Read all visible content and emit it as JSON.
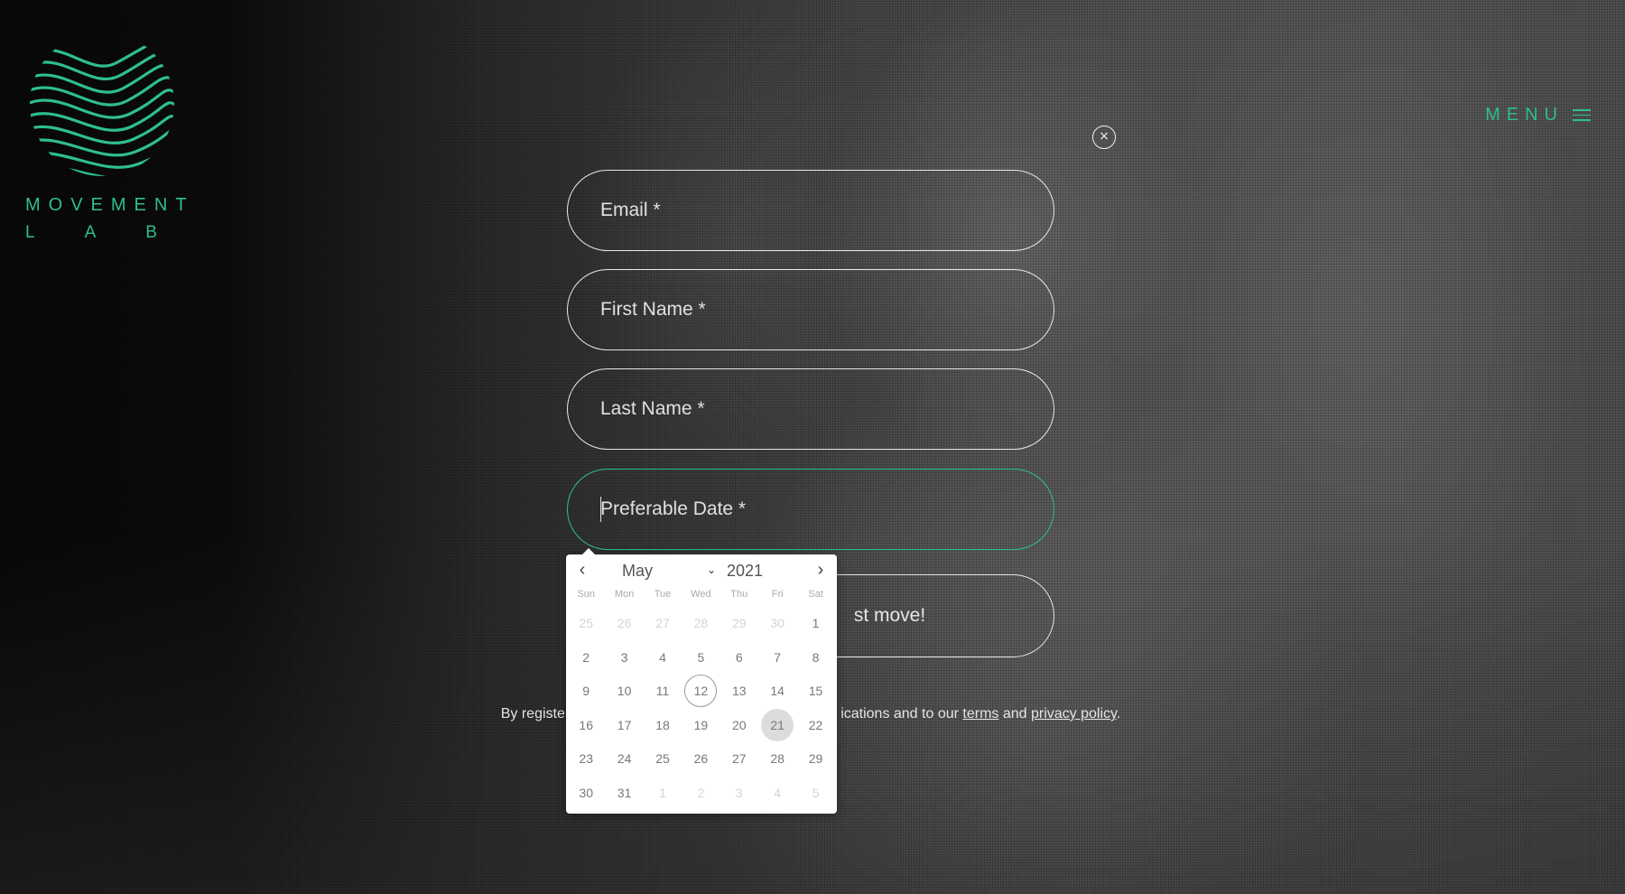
{
  "brand": {
    "line1": "MOVEMENT",
    "line2": "LAB",
    "accent_color": "#2fbf8a",
    "logo_icon": "wave-globe-icon"
  },
  "nav": {
    "menu_label": "MENU",
    "menu_icon": "hamburger-icon"
  },
  "modal": {
    "close_icon": "close-icon",
    "close_glyph": "×"
  },
  "form": {
    "email_placeholder": "Email *",
    "first_name_placeholder": "First Name *",
    "last_name_placeholder": "Last Name *",
    "date_placeholder": "Preferable Date *",
    "submit_label_visible": "st move!"
  },
  "terms": {
    "prefix": "By register",
    "middle": "ications and to our ",
    "terms_link": "terms",
    "and": " and ",
    "privacy_link": "privacy policy",
    "suffix": "."
  },
  "calendar": {
    "prev_glyph": "‹",
    "next_glyph": "›",
    "month": "May",
    "year": "2021",
    "weekdays": [
      "Sun",
      "Mon",
      "Tue",
      "Wed",
      "Thu",
      "Fri",
      "Sat"
    ],
    "today": "12",
    "selected": "21",
    "weeks": [
      [
        {
          "d": "25",
          "m": true
        },
        {
          "d": "26",
          "m": true
        },
        {
          "d": "27",
          "m": true
        },
        {
          "d": "28",
          "m": true
        },
        {
          "d": "29",
          "m": true
        },
        {
          "d": "30",
          "m": true
        },
        {
          "d": "1",
          "m": false
        }
      ],
      [
        {
          "d": "2",
          "m": false
        },
        {
          "d": "3",
          "m": false
        },
        {
          "d": "4",
          "m": false
        },
        {
          "d": "5",
          "m": false
        },
        {
          "d": "6",
          "m": false
        },
        {
          "d": "7",
          "m": false
        },
        {
          "d": "8",
          "m": false
        }
      ],
      [
        {
          "d": "9",
          "m": false
        },
        {
          "d": "10",
          "m": false
        },
        {
          "d": "11",
          "m": false
        },
        {
          "d": "12",
          "m": false
        },
        {
          "d": "13",
          "m": false
        },
        {
          "d": "14",
          "m": false
        },
        {
          "d": "15",
          "m": false
        }
      ],
      [
        {
          "d": "16",
          "m": false
        },
        {
          "d": "17",
          "m": false
        },
        {
          "d": "18",
          "m": false
        },
        {
          "d": "19",
          "m": false
        },
        {
          "d": "20",
          "m": false
        },
        {
          "d": "21",
          "m": false
        },
        {
          "d": "22",
          "m": false
        }
      ],
      [
        {
          "d": "23",
          "m": false
        },
        {
          "d": "24",
          "m": false
        },
        {
          "d": "25",
          "m": false
        },
        {
          "d": "26",
          "m": false
        },
        {
          "d": "27",
          "m": false
        },
        {
          "d": "28",
          "m": false
        },
        {
          "d": "29",
          "m": false
        }
      ],
      [
        {
          "d": "30",
          "m": false
        },
        {
          "d": "31",
          "m": false
        },
        {
          "d": "1",
          "m": true
        },
        {
          "d": "2",
          "m": true
        },
        {
          "d": "3",
          "m": true
        },
        {
          "d": "4",
          "m": true
        },
        {
          "d": "5",
          "m": true
        }
      ]
    ]
  }
}
